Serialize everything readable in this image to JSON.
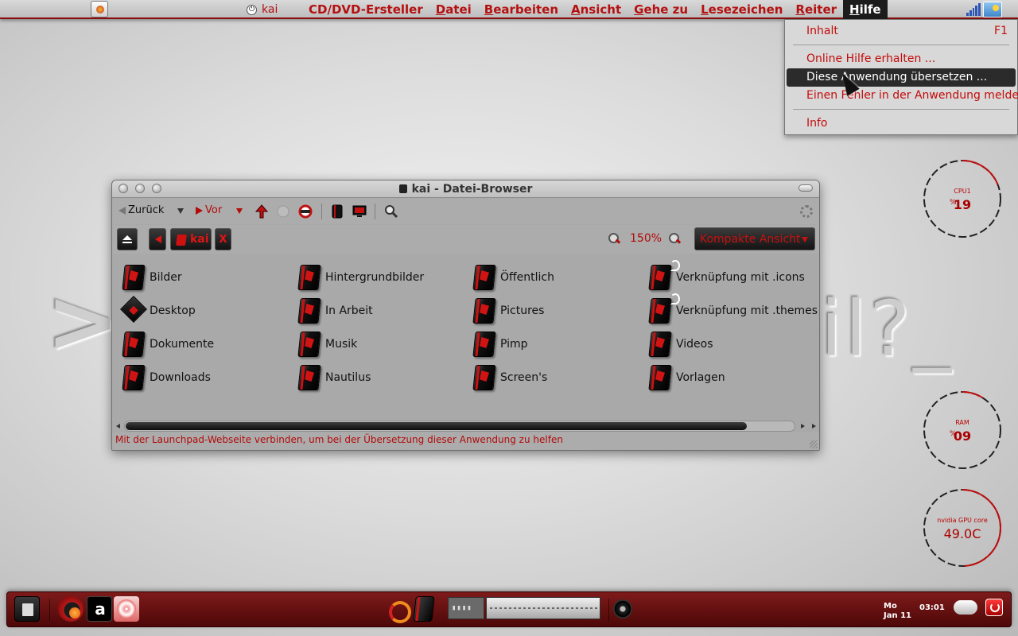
{
  "top_panel": {
    "user_label": "kai",
    "menus": [
      {
        "label": "CD/DVD-Ersteller",
        "mnemonic": "",
        "rest": "CD/DVD-Ersteller"
      },
      {
        "label": "Datei",
        "mnemonic": "D",
        "rest": "atei"
      },
      {
        "label": "Bearbeiten",
        "mnemonic": "B",
        "rest": "earbeiten"
      },
      {
        "label": "Ansicht",
        "mnemonic": "A",
        "rest": "nsicht"
      },
      {
        "label": "Gehe zu",
        "mnemonic": "G",
        "rest": "ehe zu"
      },
      {
        "label": "Lesezeichen",
        "mnemonic": "L",
        "rest": "esezeichen"
      },
      {
        "label": "Reiter",
        "mnemonic": "R",
        "rest": "eiter"
      },
      {
        "label": "Hilfe",
        "mnemonic": "H",
        "rest": "ilfe",
        "active": true
      }
    ]
  },
  "help_menu": {
    "items": [
      {
        "label": "Inhalt",
        "shortcut": "F1"
      },
      {
        "label": "Online Hilfe erhalten ..."
      },
      {
        "label": "Diese Anwendung übersetzen ...",
        "highlighted": true
      },
      {
        "label": "Einen Fehler in der Anwendung melden"
      },
      {
        "label": "Info"
      }
    ]
  },
  "wallpaper": {
    "left_glyph": ">",
    "right_text": "il?_"
  },
  "desklets": {
    "cpu": {
      "label": "CPU1",
      "unit": "%",
      "value": "19",
      "fraction": 0.19
    },
    "ram": {
      "label": "RAM",
      "unit": "%",
      "value": "09",
      "fraction": 0.09
    },
    "gpu": {
      "label": "nvidia GPU core",
      "value": "49.0C",
      "fraction": 0.49
    }
  },
  "file_browser": {
    "title": "kai - Datei-Browser",
    "toolbar": {
      "back": "Zurück",
      "forward": "Vor"
    },
    "path": {
      "current": "kai",
      "close": "X"
    },
    "zoom": "150%",
    "view_mode": "Kompakte Ansicht",
    "files": [
      {
        "name": "Bilder",
        "type": "folder"
      },
      {
        "name": "Desktop",
        "type": "desktop"
      },
      {
        "name": "Dokumente",
        "type": "folder"
      },
      {
        "name": "Downloads",
        "type": "folder"
      },
      {
        "name": "Hintergrundbilder",
        "type": "folder"
      },
      {
        "name": "In Arbeit",
        "type": "folder"
      },
      {
        "name": "Musik",
        "type": "folder"
      },
      {
        "name": "Nautilus",
        "type": "folder"
      },
      {
        "name": "Öffentlich",
        "type": "folder"
      },
      {
        "name": "Pictures",
        "type": "folder"
      },
      {
        "name": "Pimp",
        "type": "folder"
      },
      {
        "name": "Screen's",
        "type": "folder"
      },
      {
        "name": "Verknüpfung mit .icons",
        "type": "link"
      },
      {
        "name": "Verknüpfung mit .themes",
        "type": "link"
      },
      {
        "name": "Videos",
        "type": "folder"
      },
      {
        "name": "Vorlagen",
        "type": "folder"
      }
    ],
    "scroll_fraction": 0.93,
    "status": "Mit der Launchpad-Webseite verbinden, um bei der Übersetzung dieser Anwendung zu helfen"
  },
  "dock": {
    "day": "Mo",
    "date": "Jan 11",
    "time": "03:01"
  },
  "colors": {
    "accent": "#b51010",
    "panel_border": "#8a0c0c",
    "dock": "#6b1212"
  }
}
